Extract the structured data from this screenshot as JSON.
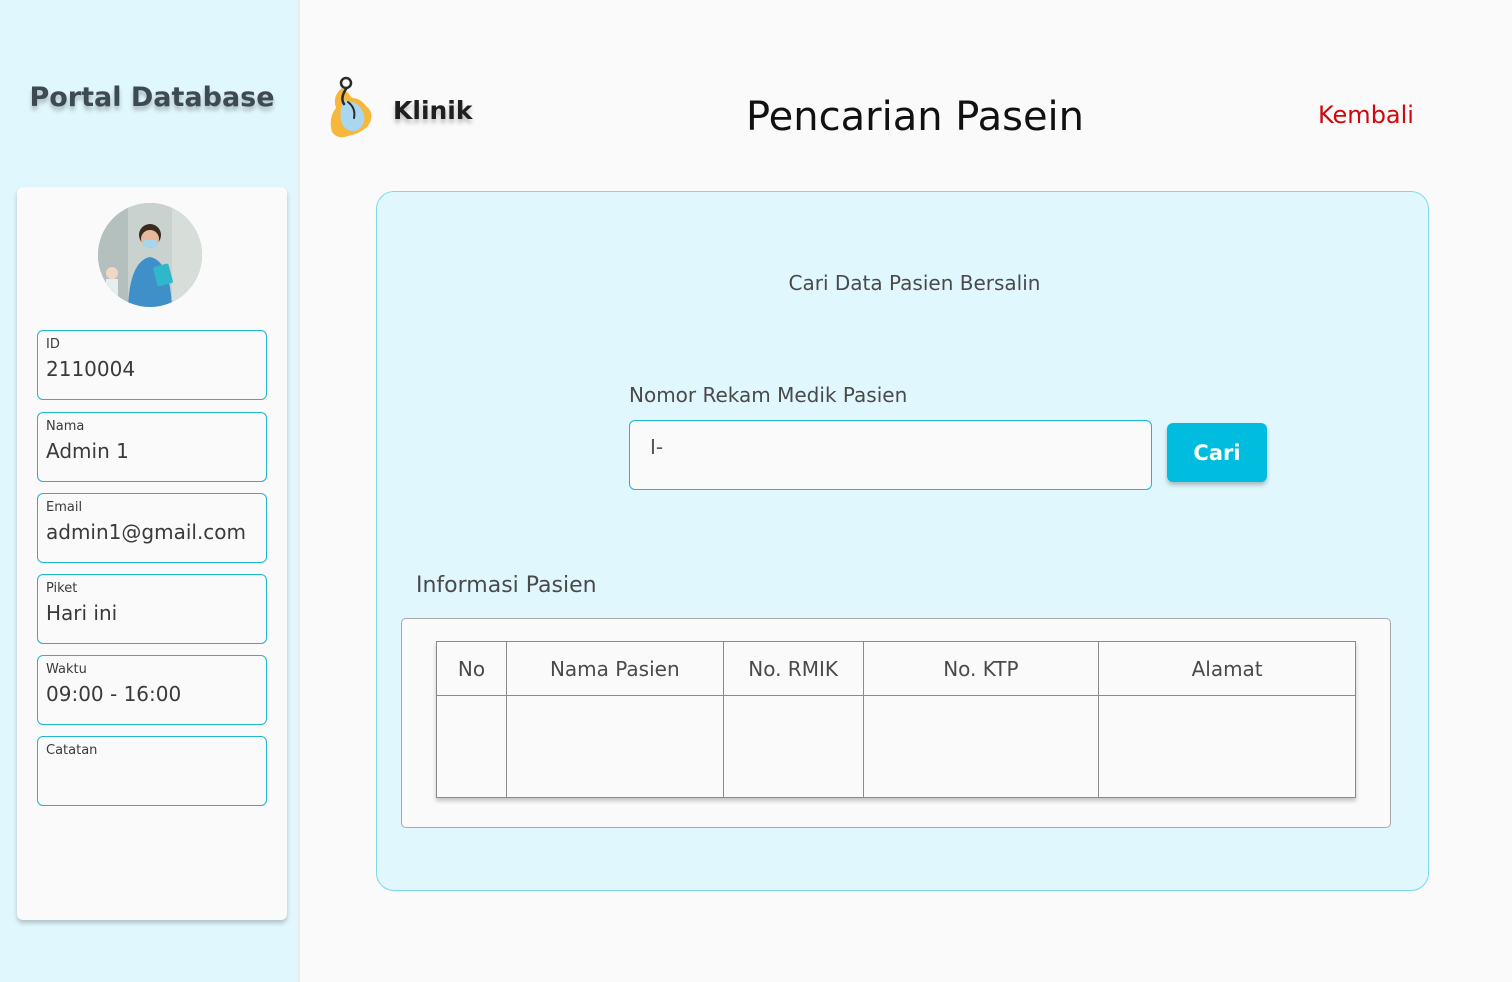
{
  "sidebar": {
    "title": "Portal Database",
    "fields": [
      {
        "label": "ID",
        "value": "2110004"
      },
      {
        "label": "Nama",
        "value": "Admin 1"
      },
      {
        "label": "Email",
        "value": "admin1@gmail.com"
      },
      {
        "label": "Piket",
        "value": "Hari ini"
      },
      {
        "label": "Waktu",
        "value": "09:00 - 16:00"
      },
      {
        "label": "Catatan",
        "value": ""
      }
    ]
  },
  "header": {
    "brand": "Klinik",
    "title": "Pencarian Pasein",
    "back_label": "Kembali",
    "back_color": "#d0070c"
  },
  "main": {
    "subtitle": "Cari Data Pasien Bersalin",
    "search": {
      "label": "Nomor Rekam Medik Pasien",
      "value": "I-",
      "button_label": "Cari"
    },
    "info_heading": "Informasi Pasien",
    "table": {
      "columns": [
        "No",
        "Nama Pasien",
        "No. RMIK",
        "No. KTP",
        "Alamat"
      ]
    }
  },
  "colors": {
    "accent": "#00bde0",
    "sidebar_bg": "#e0f7fd",
    "field_border": "#1fb6cf"
  }
}
